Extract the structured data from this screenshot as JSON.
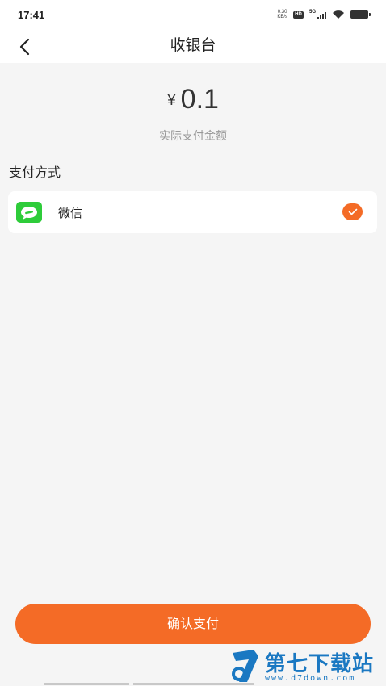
{
  "status_bar": {
    "time": "17:41",
    "net_speed_value": "0.30",
    "net_speed_unit": "KB/s",
    "hd_label": "HD",
    "network_label": "5G"
  },
  "header": {
    "title": "收银台"
  },
  "amount": {
    "currency_symbol": "¥",
    "value": "0.1",
    "caption": "实际支付金额"
  },
  "payment": {
    "section_title": "支付方式",
    "methods": [
      {
        "label": "微信",
        "icon": "wechat-icon",
        "selected": true
      }
    ]
  },
  "confirm_button": {
    "label": "确认支付"
  },
  "watermark": {
    "brand": "第七下载站",
    "url": "www.d7down.com"
  },
  "colors": {
    "accent": "#f46b26",
    "wechat_green": "#2ecc3a",
    "background": "#f5f5f5",
    "watermark_blue": "#1a78c2"
  }
}
